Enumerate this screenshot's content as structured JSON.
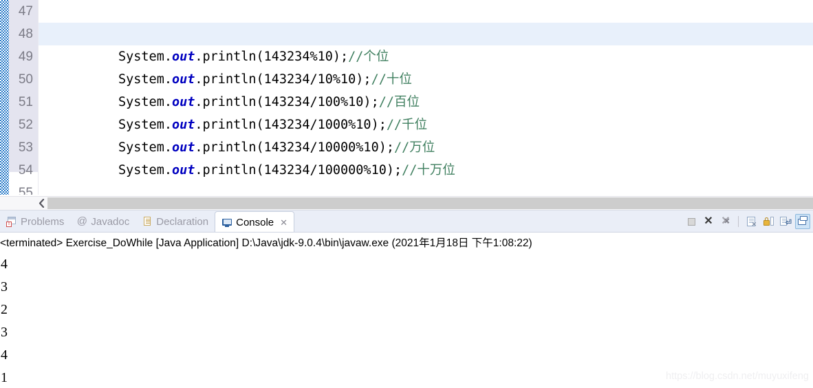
{
  "editor": {
    "lines": [
      {
        "num": "47",
        "segments": [],
        "highlight": false
      },
      {
        "num": "48",
        "segments": [],
        "highlight": true
      },
      {
        "num": "49",
        "segments": [
          {
            "t": "System.",
            "k": "plain"
          },
          {
            "t": "out",
            "k": "kw"
          },
          {
            "t": ".println(143234%10);",
            "k": "plain"
          },
          {
            "t": "//个位",
            "k": "cmt"
          }
        ],
        "highlight": false
      },
      {
        "num": "50",
        "segments": [
          {
            "t": "System.",
            "k": "plain"
          },
          {
            "t": "out",
            "k": "kw"
          },
          {
            "t": ".println(143234/10%10);",
            "k": "plain"
          },
          {
            "t": "//十位",
            "k": "cmt"
          }
        ],
        "highlight": false
      },
      {
        "num": "51",
        "segments": [
          {
            "t": "System.",
            "k": "plain"
          },
          {
            "t": "out",
            "k": "kw"
          },
          {
            "t": ".println(143234/100%10);",
            "k": "plain"
          },
          {
            "t": "//百位",
            "k": "cmt"
          }
        ],
        "highlight": false
      },
      {
        "num": "52",
        "segments": [
          {
            "t": "System.",
            "k": "plain"
          },
          {
            "t": "out",
            "k": "kw"
          },
          {
            "t": ".println(143234/1000%10);",
            "k": "plain"
          },
          {
            "t": "//千位",
            "k": "cmt"
          }
        ],
        "highlight": false
      },
      {
        "num": "53",
        "segments": [
          {
            "t": "System.",
            "k": "plain"
          },
          {
            "t": "out",
            "k": "kw"
          },
          {
            "t": ".println(143234/10000%10);",
            "k": "plain"
          },
          {
            "t": "//万位",
            "k": "cmt"
          }
        ],
        "highlight": false
      },
      {
        "num": "54",
        "segments": [
          {
            "t": "System.",
            "k": "plain"
          },
          {
            "t": "out",
            "k": "kw"
          },
          {
            "t": ".println(143234/100000%10);",
            "k": "plain"
          },
          {
            "t": "//十万位",
            "k": "cmt"
          }
        ],
        "highlight": false
      },
      {
        "num": "55",
        "segments": [],
        "highlight": false
      }
    ],
    "scrollbar": {
      "left_arrow": "scroll-left"
    },
    "colors": {
      "keyword": "#0000c0",
      "comment": "#3f7f5f",
      "current_line": "#e8f0fb",
      "gutter": "#e4e4ef"
    }
  },
  "viewbar": {
    "tabs": [
      {
        "label": "Problems",
        "icon": "problems-icon",
        "active": false
      },
      {
        "label": "Javadoc",
        "icon": "javadoc-icon",
        "active": false
      },
      {
        "label": "Declaration",
        "icon": "declaration-icon",
        "active": false
      },
      {
        "label": "Console",
        "icon": "console-icon",
        "active": true,
        "close": "✕"
      }
    ],
    "toolbar": [
      {
        "name": "terminate-button",
        "icon": "stop-square-icon"
      },
      {
        "name": "remove-launch-button",
        "icon": "close-x-icon"
      },
      {
        "name": "remove-all-terminated-button",
        "icon": "close-all-x-icon"
      },
      {
        "name": "clear-console-button",
        "icon": "clear-console-icon"
      },
      {
        "name": "scroll-lock-button",
        "icon": "lock-icon"
      },
      {
        "name": "pin-console-button",
        "icon": "pin-console-icon"
      },
      {
        "name": "display-selected-console-button",
        "icon": "display-console-icon"
      }
    ]
  },
  "console": {
    "terminated_line": "<terminated> Exercise_DoWhile [Java Application] D:\\Java\\jdk-9.0.4\\bin\\javaw.exe (2021年1月18日 下午1:08:22)",
    "output": [
      "4",
      "3",
      "2",
      "3",
      "4",
      "1"
    ]
  },
  "watermark": "https://blog.csdn.net/muyuxifeng"
}
